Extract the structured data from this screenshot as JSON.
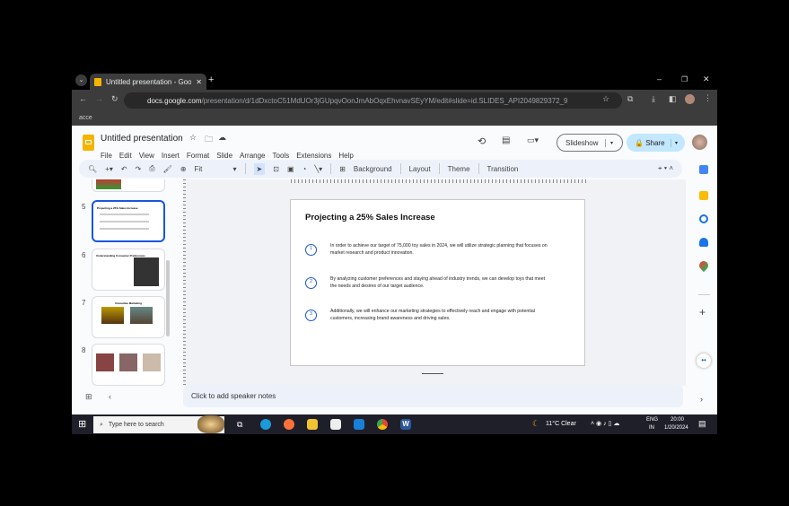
{
  "browser": {
    "tab_title": "Untitled presentation - Google",
    "url_host": "docs.google.com",
    "url_path": "/presentation/d/1dDxctoC51MdUOr3jGUpqvOonJmAbOqxEhvnavSEyYM/edit#slide=id.SLIDES_API2049829372_9",
    "bookmark": "acce"
  },
  "app": {
    "doc_title": "Untitled presentation",
    "menu": [
      "File",
      "Edit",
      "View",
      "Insert",
      "Format",
      "Slide",
      "Arrange",
      "Tools",
      "Extensions",
      "Help"
    ],
    "slideshow": "Slideshow",
    "share": "Share"
  },
  "toolbar": {
    "zoom": "Fit",
    "background": "Background",
    "layout": "Layout",
    "theme": "Theme",
    "transition": "Transition"
  },
  "filmstrip": {
    "numbers": [
      "5",
      "6",
      "7",
      "8"
    ],
    "thumb_titles": [
      "Projecting a 25% Sales Increase",
      "Understanding Consumer Preferences",
      "Innovative Marketing"
    ]
  },
  "slide": {
    "title": "Projecting a 25% Sales Increase",
    "points": [
      {
        "n": "1",
        "text": "In order to achieve our target of 75,000 toy sales in 2024, we will utilize strategic planning that focuses on market research and product innovation."
      },
      {
        "n": "2",
        "text": "By analyzing customer preferences and staying ahead of industry trends, we can develop toys that meet the needs and desires of our target audience."
      },
      {
        "n": "3",
        "text": "Additionally, we will enhance our marketing strategies to effectively reach and engage with potential customers, increasing brand awareness and driving sales."
      }
    ]
  },
  "notes": {
    "placeholder": "Click to add speaker notes"
  },
  "taskbar": {
    "search": "Type here to search",
    "weather": "11°C  Clear",
    "lang1": "ENG",
    "lang2": "IN",
    "time": "20:00",
    "date": "1/20/2024"
  }
}
